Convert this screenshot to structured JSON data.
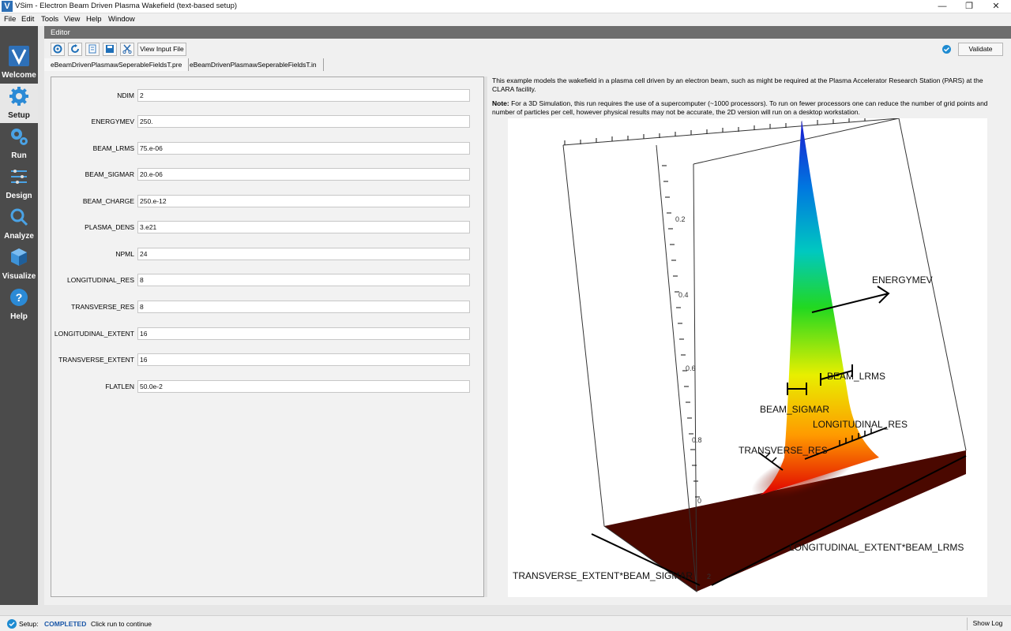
{
  "window": {
    "icon_letter": "V",
    "title": "VSim - Electron Beam Driven Plasma Wakefield (text-based setup)",
    "minimize": "—",
    "maximize": "❐",
    "close": "✕"
  },
  "menu": [
    "File",
    "Edit",
    "Tools",
    "View",
    "Help",
    "Window"
  ],
  "nav": [
    {
      "label": "Welcome",
      "icon": "vsim-logo-icon",
      "active": false
    },
    {
      "label": "Setup",
      "icon": "gear-icon",
      "active": true
    },
    {
      "label": "Run",
      "icon": "gears-icon",
      "active": false
    },
    {
      "label": "Design",
      "icon": "design-arrows-icon",
      "active": false
    },
    {
      "label": "Analyze",
      "icon": "magnifier-icon",
      "active": false
    },
    {
      "label": "Visualize",
      "icon": "cube-icon",
      "active": false
    },
    {
      "label": "Help",
      "icon": "question-icon",
      "active": false
    }
  ],
  "editor": {
    "header": "Editor",
    "view_input_file": "View Input File",
    "validate": "Validate",
    "tabs": [
      "eBeamDrivenPlasmawSeperableFieldsT.pre",
      "eBeamDrivenPlasmawSeperableFieldsT.in"
    ],
    "toolbar_icons": [
      "reload-icon",
      "refresh-icon",
      "document-icon",
      "save-icon",
      "scissors-icon"
    ]
  },
  "params": [
    {
      "label": "NDIM",
      "value": "2"
    },
    {
      "label": "ENERGYMEV",
      "value": "250."
    },
    {
      "label": "BEAM_LRMS",
      "value": "75.e-06"
    },
    {
      "label": "BEAM_SIGMAR",
      "value": "20.e-06"
    },
    {
      "label": "BEAM_CHARGE",
      "value": "250.e-12"
    },
    {
      "label": "PLASMA_DENS",
      "value": "3.e21"
    },
    {
      "label": "NPML",
      "value": "24"
    },
    {
      "label": "LONGITUDINAL_RES",
      "value": "8"
    },
    {
      "label": "TRANSVERSE_RES",
      "value": "8"
    },
    {
      "label": "LONGITUDINAL_EXTENT",
      "value": "16"
    },
    {
      "label": "TRANSVERSE_EXTENT",
      "value": "16"
    },
    {
      "label": "FLATLEN",
      "value": "50.0e-2"
    }
  ],
  "description": {
    "intro": "This example models the wakefield in a plasma cell driven by an electron beam, such as might be required at the Plasma Accelerator Research Station (PARS) at the CLARA facility.",
    "note_label": "Note:",
    "note": "For a 3D Simulation, this run requires the use of a supercomputer (~1000 processors). To run on fewer processors one can reduce the number of grid points and number of particles per cell, however physical results may not be accurate, the 2D version will run on a desktop workstation."
  },
  "figure": {
    "labels": {
      "energy": "ENERGYMEV",
      "lrms": "BEAM_LRMS",
      "sigmar": "BEAM_SIGMAR",
      "long_res": "LONGITUDINAL_RES",
      "trans_res": "TRANSVERSE_RES",
      "long_extent": "LONGITUDINAL_EXTENT*BEAM_LRMS",
      "trans_extent": "TRANSVERSE_EXTENT*BEAM_SIGMAR"
    },
    "axis_ticks": [
      "0.2",
      "0.4",
      "0.6",
      "0.8",
      "0",
      "2"
    ]
  },
  "status": {
    "label": "Setup:",
    "state": "COMPLETED",
    "message": "Click run to continue",
    "show_log": "Show Log"
  }
}
